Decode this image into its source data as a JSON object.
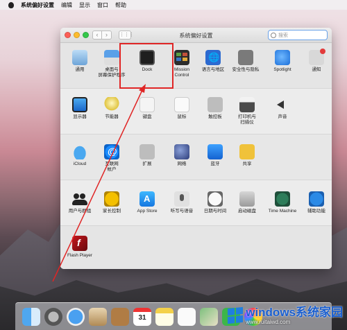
{
  "menubar": {
    "app_name": "系统偏好设置",
    "items": [
      "编辑",
      "显示",
      "窗口",
      "帮助"
    ]
  },
  "window": {
    "title": "系统偏好设置",
    "search_placeholder": "搜索",
    "back_glyph": "‹",
    "forward_glyph": "›",
    "grid_glyph": "⋮⋮⋮"
  },
  "panes": {
    "general": "通用",
    "desktop": "桌面与\n屏幕保护程序",
    "dock": "Dock",
    "mission_control": "Mission\nControl",
    "language": "语言与地区",
    "security": "安全性与隐私",
    "spotlight": "Spotlight",
    "notifications": "通知",
    "displays": "显示器",
    "energy": "节能器",
    "keyboard": "键盘",
    "mouse": "鼠标",
    "trackpad": "触控板",
    "printers": "打印机与\n扫描仪",
    "sound": "声音",
    "icloud": "iCloud",
    "internet_accounts": "互联网\n帐户",
    "extensions": "扩展",
    "network": "网络",
    "bluetooth": "蓝牙",
    "sharing": "共享",
    "users": "用户与群组",
    "parental": "家长控制",
    "appstore": "App Store",
    "dictation": "听写与语音",
    "datetime": "日期与时间",
    "startup": "启动磁盘",
    "timemachine": "Time Machine",
    "accessibility": "辅助功能",
    "flash": "Flash Player"
  },
  "dock": {
    "calendar_day": "31"
  },
  "watermark": {
    "main": "windows系统家园",
    "sub": "www.ruitaiwd.com"
  },
  "colors": {
    "highlight": "#e02525",
    "search_focus": "#6aa2e8"
  }
}
